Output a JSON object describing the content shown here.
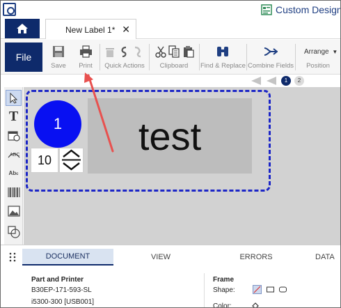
{
  "titlebar": {
    "app_title": "Custom Designe"
  },
  "tabs": {
    "home_label": "Home",
    "document_tab": "New Label 1*",
    "close_glyph": "✕"
  },
  "ribbon": {
    "file_label": "File",
    "save_label": "Save",
    "print_label": "Print",
    "quick_actions_label": "Quick Actions",
    "clipboard_label": "Clipboard",
    "find_replace_label": "Find & Replace",
    "combine_fields_label": "Combine Fields",
    "arrange_label": "Arrange",
    "position_label": "Position"
  },
  "page_nav": {
    "current": "1",
    "next": "2"
  },
  "canvas": {
    "circle_text": "1",
    "text_object": "test",
    "number_value": "10"
  },
  "bottom_tabs": {
    "document": "DOCUMENT",
    "view": "VIEW",
    "errors": "ERRORS",
    "data": "DATA"
  },
  "part_printer": {
    "title": "Part and Printer",
    "part": "B30EP-171-593-SL",
    "printer": "i5300-300 [USB001]"
  },
  "frame": {
    "title": "Frame",
    "shape_label": "Shape:",
    "color_label": "Color:"
  },
  "colors": {
    "brand": "#0e2a6b",
    "selection": "#1b25c7",
    "circle": "#0810f2",
    "arrow": "#e8514f"
  }
}
